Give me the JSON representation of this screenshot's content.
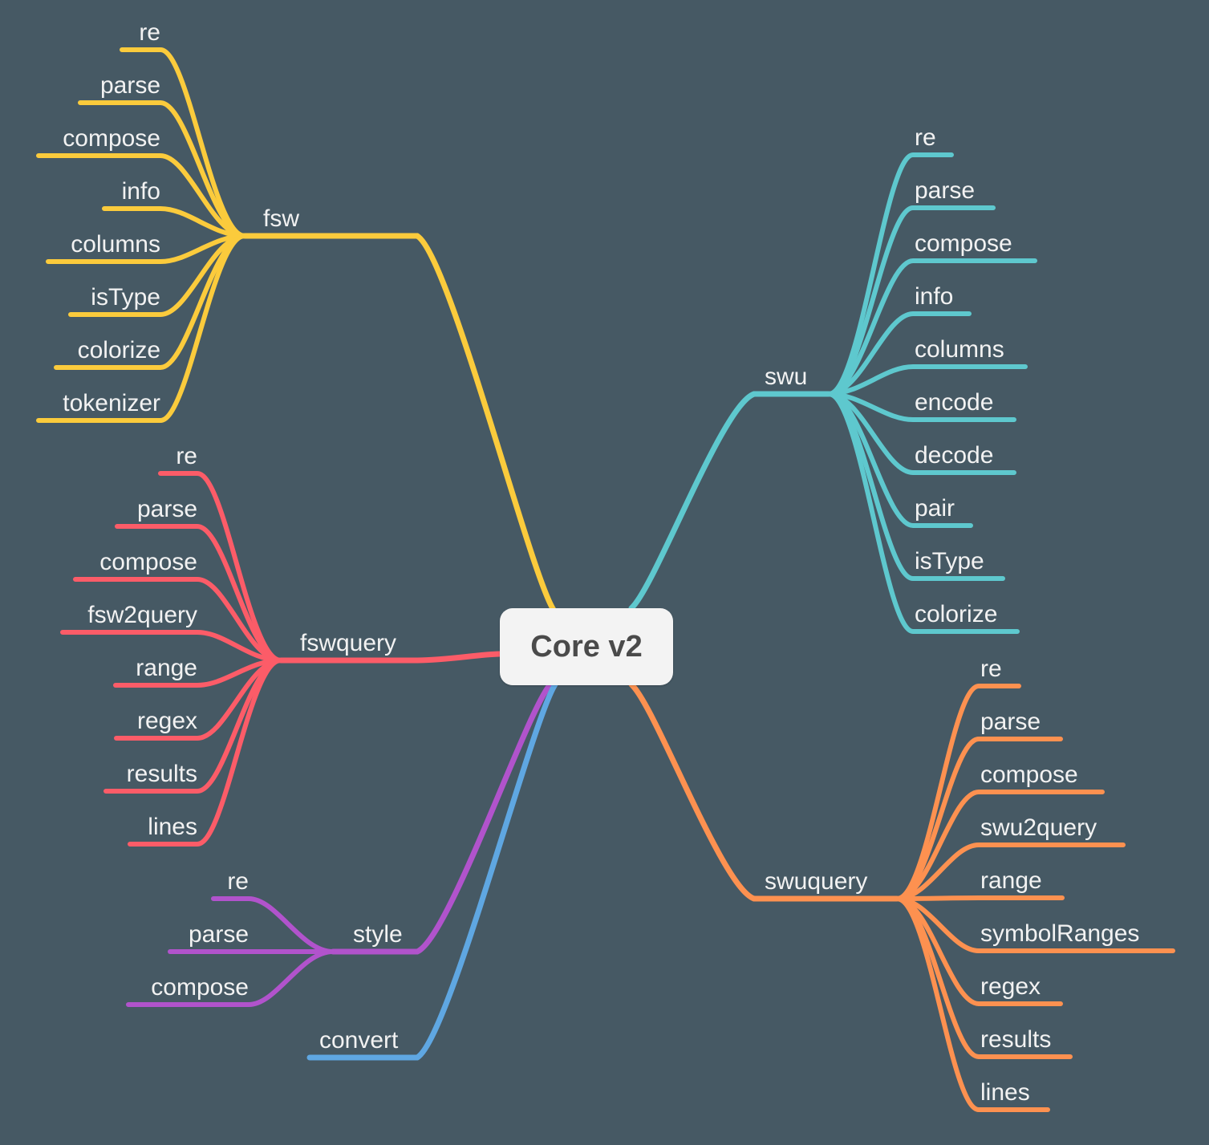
{
  "root": {
    "label": "Core v2"
  },
  "background": "#465964",
  "branches": [
    {
      "label": "fsw",
      "side": "left",
      "color": "#fbcb3c",
      "children": [
        "re",
        "parse",
        "compose",
        "info",
        "columns",
        "isType",
        "colorize",
        "tokenizer"
      ]
    },
    {
      "label": "fswquery",
      "side": "left",
      "color": "#fc5c68",
      "children": [
        "re",
        "parse",
        "compose",
        "fsw2query",
        "range",
        "regex",
        "results",
        "lines"
      ]
    },
    {
      "label": "style",
      "side": "left",
      "color": "#b153cc",
      "children": [
        "re",
        "parse",
        "compose"
      ]
    },
    {
      "label": "convert",
      "side": "left",
      "color": "#5fa7e2",
      "children": []
    },
    {
      "label": "swu",
      "side": "right",
      "color": "#5ec8ce",
      "children": [
        "re",
        "parse",
        "compose",
        "info",
        "columns",
        "encode",
        "decode",
        "pair",
        "isType",
        "colorize"
      ]
    },
    {
      "label": "swuquery",
      "side": "right",
      "color": "#fd9150",
      "children": [
        "re",
        "parse",
        "compose",
        "swu2query",
        "range",
        "symbolRanges",
        "regex",
        "results",
        "lines"
      ]
    }
  ]
}
